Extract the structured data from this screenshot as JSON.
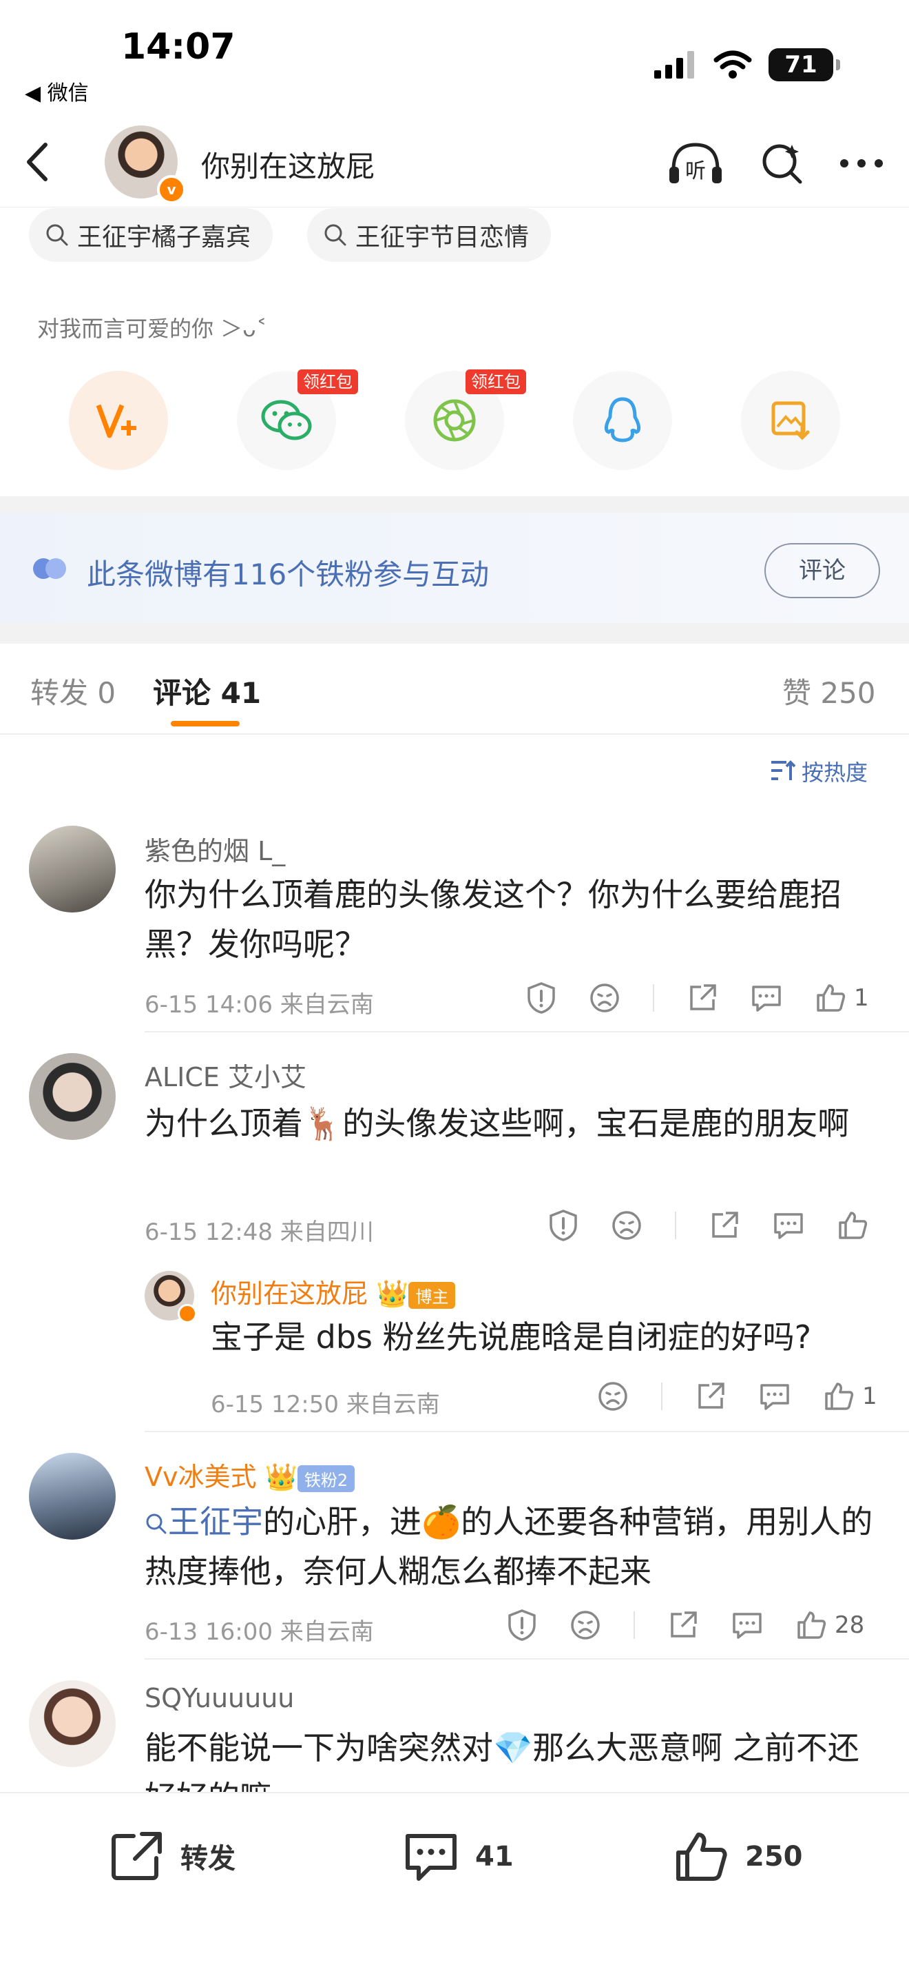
{
  "status_bar": {
    "time": "14:07",
    "back_app": "◀ 微信",
    "battery": "71"
  },
  "nav": {
    "title": "你别在这放屁"
  },
  "search_chips": [
    "王征宇橘子嘉宾",
    "王征宇节目恋情"
  ],
  "share_tooltip": "对我而言可爱的你 ＞ᴗ˂",
  "share": {
    "redpack_label": "领红包"
  },
  "fans_banner": {
    "text": "此条微博有116个铁粉参与互动",
    "button": "评论"
  },
  "tabs": {
    "repost": "转发 0",
    "comments": "评论 41",
    "likes": "赞 250"
  },
  "sort_label": "按热度",
  "comments": [
    {
      "user": "紫色的烟 L_",
      "text": "你为什么顶着鹿的头像发这个？你为什么要给鹿招黑？发你吗呢？",
      "meta": "6-15 14:06  来自云南",
      "likes": "1"
    },
    {
      "user": "ALICE 艾小艾",
      "text_a": "为什么顶着",
      "text_b": "的头像发这些啊，宝石是鹿的朋友啊",
      "meta": "6-15 12:48  来自四川",
      "likes": ""
    },
    {
      "user": "你别在这放屁",
      "badge": "博主",
      "text": "宝子是 dbs 粉丝先说鹿晗是自闭症的好吗?",
      "meta": "6-15 12:50  来自云南",
      "likes": "1"
    },
    {
      "user": "Vv冰美式",
      "badge": "铁粉2",
      "topic": "王征宇",
      "text_a": "的心肝，进",
      "text_b": "的人还要各种营销，用别人的热度捧他，奈何人糊怎么都捧不起来",
      "meta": "6-13 16:00  来自云南",
      "likes": "28"
    },
    {
      "user": "SQYuuuuuu",
      "text_a": "能不能说一下为啥突然对",
      "text_b": "那么大恶意啊 之前不还好好的嘛"
    }
  ],
  "bottom_bar": {
    "repost": "转发",
    "comments": "41",
    "likes": "250"
  },
  "colors": {
    "accent": "#ff8200",
    "link": "#4a6fb5"
  }
}
